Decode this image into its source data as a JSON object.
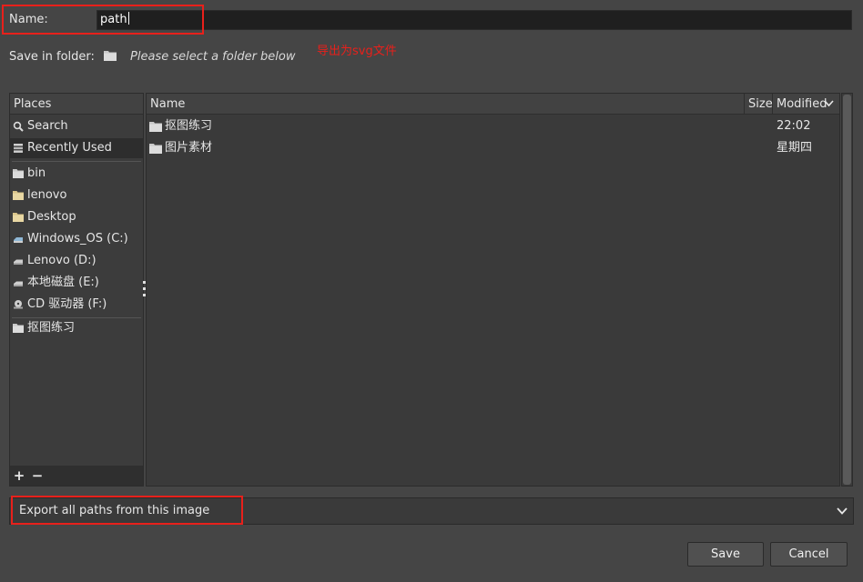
{
  "name_row": {
    "label": "Name:",
    "value": "path"
  },
  "folder_row": {
    "label": "Save in folder:",
    "hint": "Please select a folder below",
    "icon": "folder-icon"
  },
  "annotation": {
    "text": "导出为svg文件",
    "color": "#e8201b"
  },
  "places": {
    "header": "Places",
    "items": [
      {
        "label": "Search",
        "icon": "search-icon"
      },
      {
        "label": "Recently Used",
        "icon": "recent-icon",
        "selected": true
      },
      {
        "label": "bin",
        "icon": "folder-icon"
      },
      {
        "label": "lenovo",
        "icon": "folder-icon"
      },
      {
        "label": "Desktop",
        "icon": "folder-icon"
      },
      {
        "label": "Windows_OS (C:)",
        "icon": "drive-icon"
      },
      {
        "label": "Lenovo (D:)",
        "icon": "drive-icon"
      },
      {
        "label": "本地磁盘 (E:)",
        "icon": "drive-icon"
      },
      {
        "label": "CD 驱动器 (F:)",
        "icon": "cd-drive-icon"
      },
      {
        "label": "抠图练习",
        "icon": "folder-icon"
      }
    ],
    "add_label": "+",
    "remove_label": "−"
  },
  "files": {
    "columns": {
      "name": "Name",
      "size": "Size",
      "modified": "Modified"
    },
    "rows": [
      {
        "name": "抠图练习",
        "modified": "22:02",
        "icon": "folder-icon"
      },
      {
        "name": "图片素材",
        "modified": "星期四",
        "icon": "folder-icon"
      }
    ]
  },
  "filter": {
    "value": "Export all paths from this image"
  },
  "buttons": {
    "save": "Save",
    "cancel": "Cancel"
  },
  "colors": {
    "background": "#454545",
    "highlight": "#e8201b"
  }
}
